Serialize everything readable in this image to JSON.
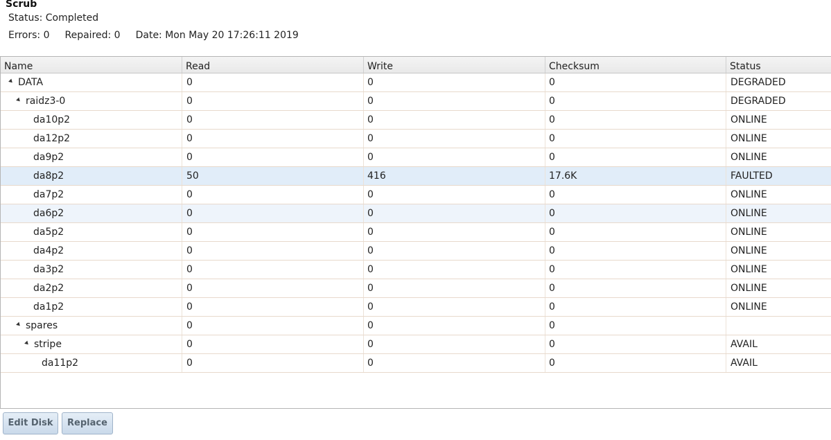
{
  "scrub": {
    "title": "Scrub",
    "status": "Status: Completed",
    "errors": "Errors: 0",
    "repaired": "Repaired: 0",
    "date": "Date: Mon May 20 17:26:11 2019"
  },
  "grid": {
    "columns": [
      "Name",
      "Read",
      "Write",
      "Checksum",
      "Status"
    ],
    "rows": [
      {
        "name": "DATA",
        "read": "0",
        "write": "0",
        "checksum": "0",
        "status": "DEGRADED"
      },
      {
        "name": "raidz3-0",
        "read": "0",
        "write": "0",
        "checksum": "0",
        "status": "DEGRADED"
      },
      {
        "name": "da10p2",
        "read": "0",
        "write": "0",
        "checksum": "0",
        "status": "ONLINE"
      },
      {
        "name": "da12p2",
        "read": "0",
        "write": "0",
        "checksum": "0",
        "status": "ONLINE"
      },
      {
        "name": "da9p2",
        "read": "0",
        "write": "0",
        "checksum": "0",
        "status": "ONLINE"
      },
      {
        "name": "da8p2",
        "read": "50",
        "write": "416",
        "checksum": "17.6K",
        "status": "FAULTED"
      },
      {
        "name": "da7p2",
        "read": "0",
        "write": "0",
        "checksum": "0",
        "status": "ONLINE"
      },
      {
        "name": "da6p2",
        "read": "0",
        "write": "0",
        "checksum": "0",
        "status": "ONLINE"
      },
      {
        "name": "da5p2",
        "read": "0",
        "write": "0",
        "checksum": "0",
        "status": "ONLINE"
      },
      {
        "name": "da4p2",
        "read": "0",
        "write": "0",
        "checksum": "0",
        "status": "ONLINE"
      },
      {
        "name": "da3p2",
        "read": "0",
        "write": "0",
        "checksum": "0",
        "status": "ONLINE"
      },
      {
        "name": "da2p2",
        "read": "0",
        "write": "0",
        "checksum": "0",
        "status": "ONLINE"
      },
      {
        "name": "da1p2",
        "read": "0",
        "write": "0",
        "checksum": "0",
        "status": "ONLINE"
      },
      {
        "name": "spares",
        "read": "0",
        "write": "0",
        "checksum": "0",
        "status": ""
      },
      {
        "name": "stripe",
        "read": "0",
        "write": "0",
        "checksum": "0",
        "status": "AVAIL"
      },
      {
        "name": "da11p2",
        "read": "0",
        "write": "0",
        "checksum": "0",
        "status": "AVAIL"
      }
    ]
  },
  "buttons": {
    "edit_disk": "Edit Disk",
    "replace": "Replace"
  },
  "icons": {
    "expander": "expanded-triangle-icon"
  }
}
